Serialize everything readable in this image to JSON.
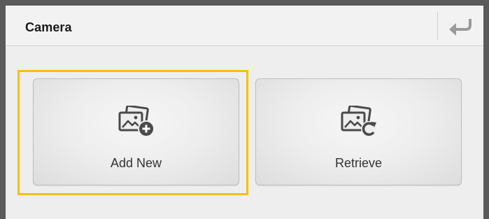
{
  "header": {
    "title": "Camera",
    "back_icon": "back-arrow-icon"
  },
  "tiles": [
    {
      "label": "Add New",
      "icon": "photos-add-icon",
      "focused": true
    },
    {
      "label": "Retrieve",
      "icon": "photos-refresh-icon",
      "focused": false
    }
  ],
  "colors": {
    "focus_ring": "#f7c000",
    "icon": "#4a4a4a",
    "frame": "#5a5a5a",
    "panel": "#eeeeee"
  }
}
